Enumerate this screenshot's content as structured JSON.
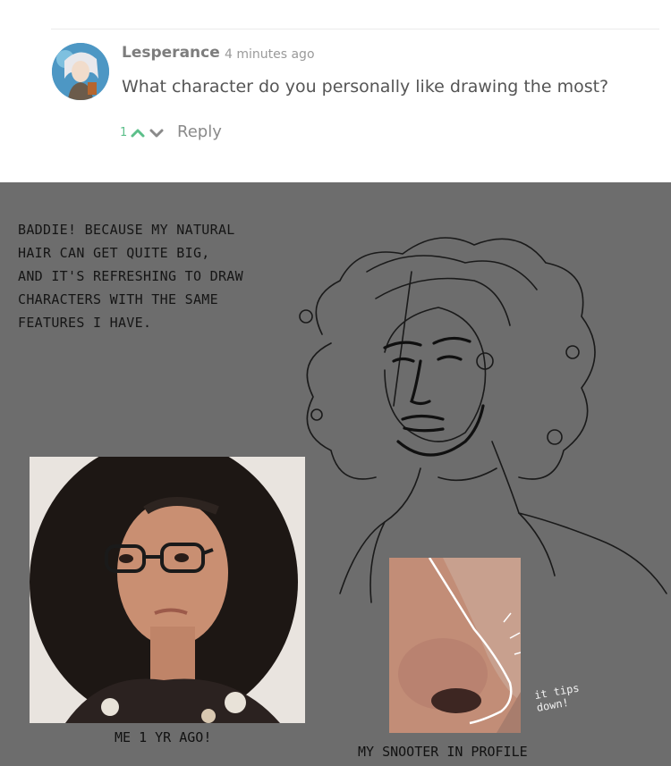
{
  "comment": {
    "username": "Lesperance",
    "timestamp": "4 minutes ago",
    "text": "What character do you personally like drawing the most?",
    "vote_count": "1",
    "reply_label": "Reply",
    "accent_color": "#5cbf8a",
    "upvote_icon": "chevron-up-icon",
    "downvote_icon": "chevron-down-icon"
  },
  "panel": {
    "text_lines": [
      "BADDIE! BECAUSE MY NATURAL",
      "HAIR CAN GET QUITE BIG,",
      "AND IT'S REFRESHING TO DRAW",
      "CHARACTERS WITH THE SAME",
      "FEATURES I HAVE."
    ],
    "photo_caption": "ME 1 YR AGO!",
    "nose_annotation": "it tips down!",
    "nose_caption": "MY SNOOTER IN PROFILE",
    "background_color": "#6d6d6d"
  }
}
